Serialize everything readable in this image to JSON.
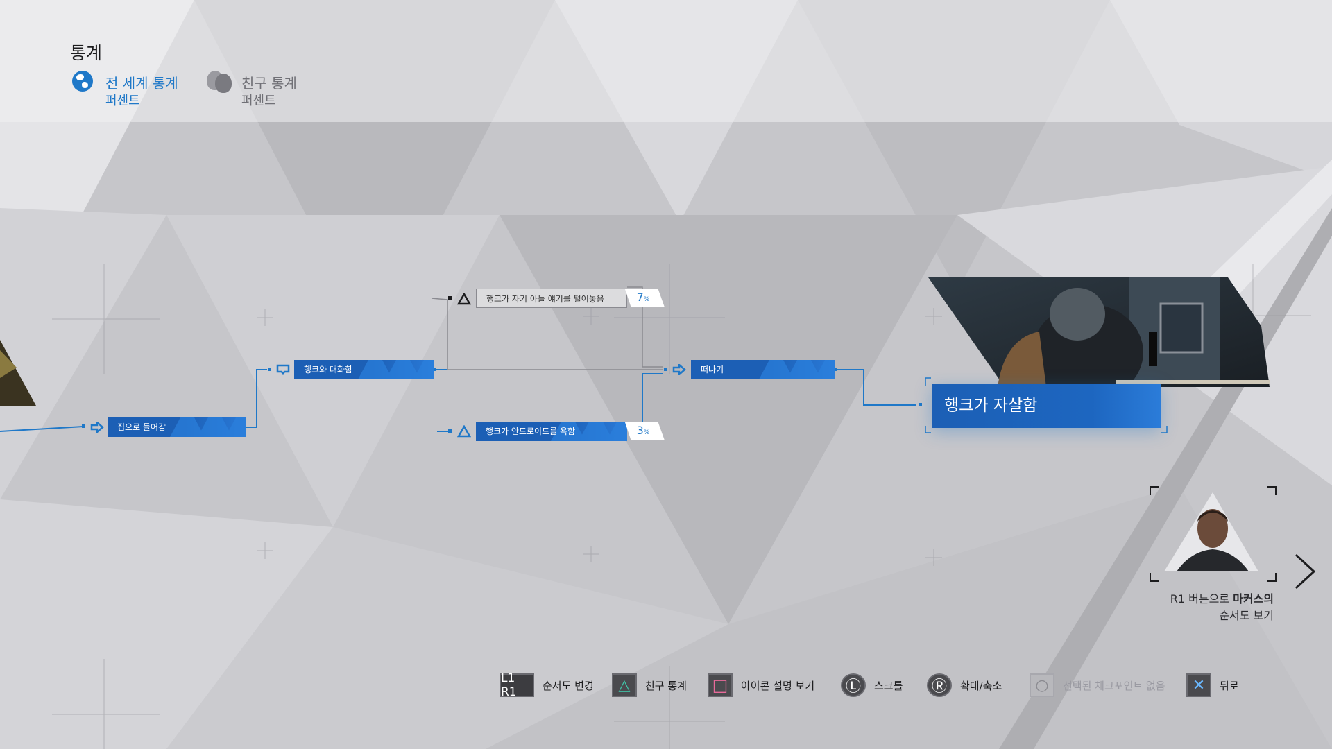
{
  "header": {
    "title": "통계",
    "tabs": [
      {
        "name": "전 세계 통계",
        "sub": "퍼센트",
        "active": true,
        "icon": "globe-icon"
      },
      {
        "name": "친구 통계",
        "sub": "퍼센트",
        "active": false,
        "icon": "friends-icon"
      }
    ]
  },
  "flowchart": {
    "nodes": {
      "enter_house": "집으로 들어감",
      "talk_hank": "행크와 대화함",
      "hank_son": "행크가 자기 아들 얘기를 털어놓음",
      "hank_insult": "행크가 안드로이드를 욕함",
      "leave": "떠나기",
      "final": "행크가 자살함"
    },
    "percents": {
      "hank_son": "7",
      "hank_insult": "3",
      "unit": "%"
    }
  },
  "character": {
    "hint_prefix": "R1 버튼으로 ",
    "hint_name": "마커스의",
    "hint_suffix": "순서도 보기"
  },
  "footer": [
    {
      "icon_text": "L1 R1",
      "label": "순서도 변경",
      "icon": "l1-r1-button-icon"
    },
    {
      "icon_text": "△",
      "label": "친구 통계",
      "icon": "triangle-button-icon"
    },
    {
      "icon_text": "□",
      "label": "아이콘 설명 보기",
      "icon": "square-button-icon"
    },
    {
      "icon_text": "Ⓛ",
      "label": "스크롤",
      "icon": "left-stick-icon"
    },
    {
      "icon_text": "Ⓡ",
      "label": "확대/축소",
      "icon": "right-stick-icon"
    },
    {
      "icon_text": "○",
      "label": "선택된 체크포인트 없음",
      "icon": "circle-button-icon",
      "disabled": true
    },
    {
      "icon_text": "✕",
      "label": "뒤로",
      "icon": "cross-button-icon"
    }
  ],
  "colors": {
    "accent": "#1f78c8",
    "node_blue": "#1c5fb5",
    "background": "#c9c9cc"
  }
}
